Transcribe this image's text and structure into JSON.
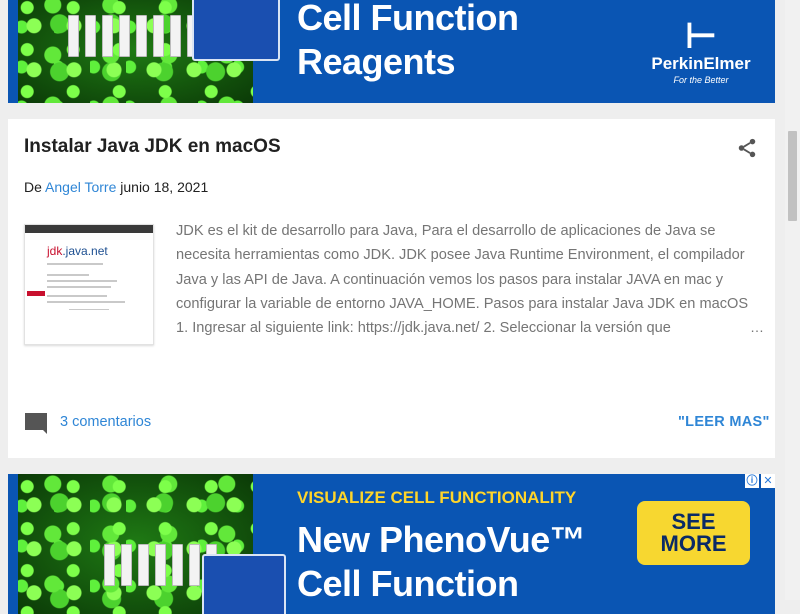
{
  "ad_top": {
    "line1": "Cell Function",
    "line2": "Reagents",
    "brand": "PerkinElmer",
    "brand_tagline": "For the Better"
  },
  "post": {
    "title": "Instalar Java JDK en macOS",
    "byline_prefix": "De",
    "author": "Angel Torre",
    "date": "junio 18, 2021",
    "thumbnail_logo_red": "jdk",
    "thumbnail_logo_rest": ".java.net",
    "excerpt": "JDK es el kit de desarrollo para Java, Para el desarrollo de aplicaciones de Java se necesita herramientas como JDK. JDK posee Java Runtime Environment, el compilador Java y las API de Java. A continuación vemos los pasos para instalar JAVA en mac y configurar la variable de entorno JAVA_HOME. Pasos para instalar Java JDK en macOS 1. Ingresar al siguiente link: https://jdk.java.net/ 2. Seleccionar la versión que",
    "ellipsis": "…",
    "comments_label": "3 comentarios",
    "read_more_label": "\"LEER MAS\""
  },
  "ad_bottom": {
    "kicker": "VISUALIZE CELL FUNCTIONALITY",
    "line1": "New PhenoVue™",
    "line2": "Cell Function",
    "cta_line1": "SEE",
    "cta_line2": "MORE",
    "adchoices_icon": "ⓘ",
    "close_icon": "✕"
  },
  "colors": {
    "ad_blue": "#0a55b3",
    "link_blue": "#2f86d6",
    "cta_yellow": "#f7d730"
  }
}
